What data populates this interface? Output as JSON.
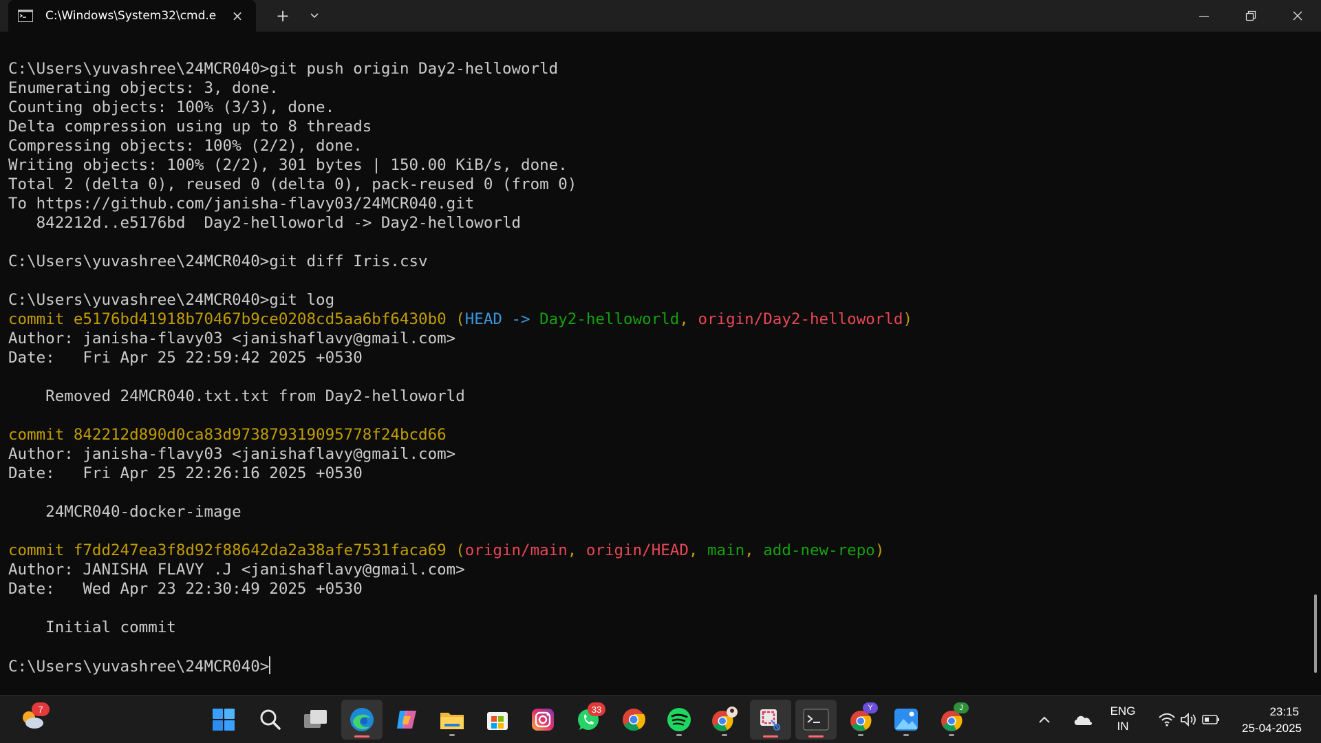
{
  "window": {
    "tab_title": "C:\\Windows\\System32\\cmd.e",
    "close_tab_glyph": "×",
    "new_tab_glyph": "+",
    "dropdown_glyph": "⌄"
  },
  "console": {
    "lines": [
      {
        "segments": [
          {
            "text": "C:\\Users\\yuvashree\\24MCR040>git push origin Day2-helloworld",
            "color": "default"
          }
        ]
      },
      {
        "segments": [
          {
            "text": "Enumerating objects: 3, done.",
            "color": "default"
          }
        ]
      },
      {
        "segments": [
          {
            "text": "Counting objects: 100% (3/3), done.",
            "color": "default"
          }
        ]
      },
      {
        "segments": [
          {
            "text": "Delta compression using up to 8 threads",
            "color": "default"
          }
        ]
      },
      {
        "segments": [
          {
            "text": "Compressing objects: 100% (2/2), done.",
            "color": "default"
          }
        ]
      },
      {
        "segments": [
          {
            "text": "Writing objects: 100% (2/2), 301 bytes | 150.00 KiB/s, done.",
            "color": "default"
          }
        ]
      },
      {
        "segments": [
          {
            "text": "Total 2 (delta 0), reused 0 (delta 0), pack-reused 0 (from 0)",
            "color": "default"
          }
        ]
      },
      {
        "segments": [
          {
            "text": "To https://github.com/janisha-flavy03/24MCR040.git",
            "color": "default"
          }
        ]
      },
      {
        "segments": [
          {
            "text": "   842212d..e5176bd  Day2-helloworld -> Day2-helloworld",
            "color": "default"
          }
        ]
      },
      {
        "segments": [
          {
            "text": "",
            "color": "default"
          }
        ]
      },
      {
        "segments": [
          {
            "text": "C:\\Users\\yuvashree\\24MCR040>git diff Iris.csv",
            "color": "default"
          }
        ]
      },
      {
        "segments": [
          {
            "text": "",
            "color": "default"
          }
        ]
      },
      {
        "segments": [
          {
            "text": "C:\\Users\\yuvashree\\24MCR040>git log",
            "color": "default"
          }
        ]
      },
      {
        "segments": [
          {
            "text": "commit e5176bd41918b70467b9ce0208cd5aa6bf6430b0 (",
            "color": "yellow"
          },
          {
            "text": "HEAD -> ",
            "color": "cyan"
          },
          {
            "text": "Day2-helloworld",
            "color": "green"
          },
          {
            "text": ", ",
            "color": "yellow"
          },
          {
            "text": "origin/Day2-helloworld",
            "color": "red"
          },
          {
            "text": ")",
            "color": "yellow"
          }
        ]
      },
      {
        "segments": [
          {
            "text": "Author: janisha-flavy03 <janishaflavy@gmail.com>",
            "color": "default"
          }
        ]
      },
      {
        "segments": [
          {
            "text": "Date:   Fri Apr 25 22:59:42 2025 +0530",
            "color": "default"
          }
        ]
      },
      {
        "segments": [
          {
            "text": "",
            "color": "default"
          }
        ]
      },
      {
        "segments": [
          {
            "text": "    Removed 24MCR040.txt.txt from Day2-helloworld",
            "color": "default"
          }
        ]
      },
      {
        "segments": [
          {
            "text": "",
            "color": "default"
          }
        ]
      },
      {
        "segments": [
          {
            "text": "commit 842212d890d0ca83d973879319095778f24bcd66",
            "color": "yellow"
          }
        ]
      },
      {
        "segments": [
          {
            "text": "Author: janisha-flavy03 <janishaflavy@gmail.com>",
            "color": "default"
          }
        ]
      },
      {
        "segments": [
          {
            "text": "Date:   Fri Apr 25 22:26:16 2025 +0530",
            "color": "default"
          }
        ]
      },
      {
        "segments": [
          {
            "text": "",
            "color": "default"
          }
        ]
      },
      {
        "segments": [
          {
            "text": "    24MCR040-docker-image",
            "color": "default"
          }
        ]
      },
      {
        "segments": [
          {
            "text": "",
            "color": "default"
          }
        ]
      },
      {
        "segments": [
          {
            "text": "commit f7dd247ea3f8d92f88642da2a38afe7531faca69 (",
            "color": "yellow"
          },
          {
            "text": "origin/main",
            "color": "red"
          },
          {
            "text": ", ",
            "color": "yellow"
          },
          {
            "text": "origin/HEAD",
            "color": "red"
          },
          {
            "text": ", ",
            "color": "yellow"
          },
          {
            "text": "main",
            "color": "green"
          },
          {
            "text": ", ",
            "color": "yellow"
          },
          {
            "text": "add-new-repo",
            "color": "green"
          },
          {
            "text": ")",
            "color": "yellow"
          }
        ]
      },
      {
        "segments": [
          {
            "text": "Author: JANISHA FLAVY .J <janishaflavy@gmail.com>",
            "color": "default"
          }
        ]
      },
      {
        "segments": [
          {
            "text": "Date:   Wed Apr 23 22:30:49 2025 +0530",
            "color": "default"
          }
        ]
      },
      {
        "segments": [
          {
            "text": "",
            "color": "default"
          }
        ]
      },
      {
        "segments": [
          {
            "text": "    Initial commit",
            "color": "default"
          }
        ]
      },
      {
        "segments": [
          {
            "text": "",
            "color": "default"
          }
        ]
      },
      {
        "segments": [
          {
            "text": "C:\\Users\\yuvashree\\24MCR040>",
            "color": "default"
          }
        ],
        "cursor": true
      }
    ]
  },
  "colors": {
    "default": "#cccccc",
    "yellow": "#c19c00",
    "cyan": "#3a96dd",
    "green": "#13a10e",
    "red": "#e74856",
    "titlebar_bg": "#202020",
    "console_bg": "#0c0c0c",
    "taskbar_bg": "#1c1c1c"
  },
  "taskbar": {
    "weather_badge": "7",
    "whatsapp_badge": "33",
    "chrome_profile_y": "Y",
    "chrome_profile_j": "J",
    "language_line1": "ENG",
    "language_line2": "IN",
    "time": "23:15",
    "date": "25-04-2025",
    "icons": [
      "weather-icon",
      "start-icon",
      "search-icon",
      "task-view-icon",
      "edge-icon",
      "copilot-icon",
      "file-explorer-icon",
      "store-icon",
      "instagram-icon",
      "whatsapp-icon",
      "chrome-icon",
      "spotify-icon",
      "chrome-profile-icon",
      "snipping-tool-icon",
      "terminal-icon",
      "chrome-profile-y-icon",
      "photos-icon",
      "chrome-profile-j-icon"
    ]
  }
}
